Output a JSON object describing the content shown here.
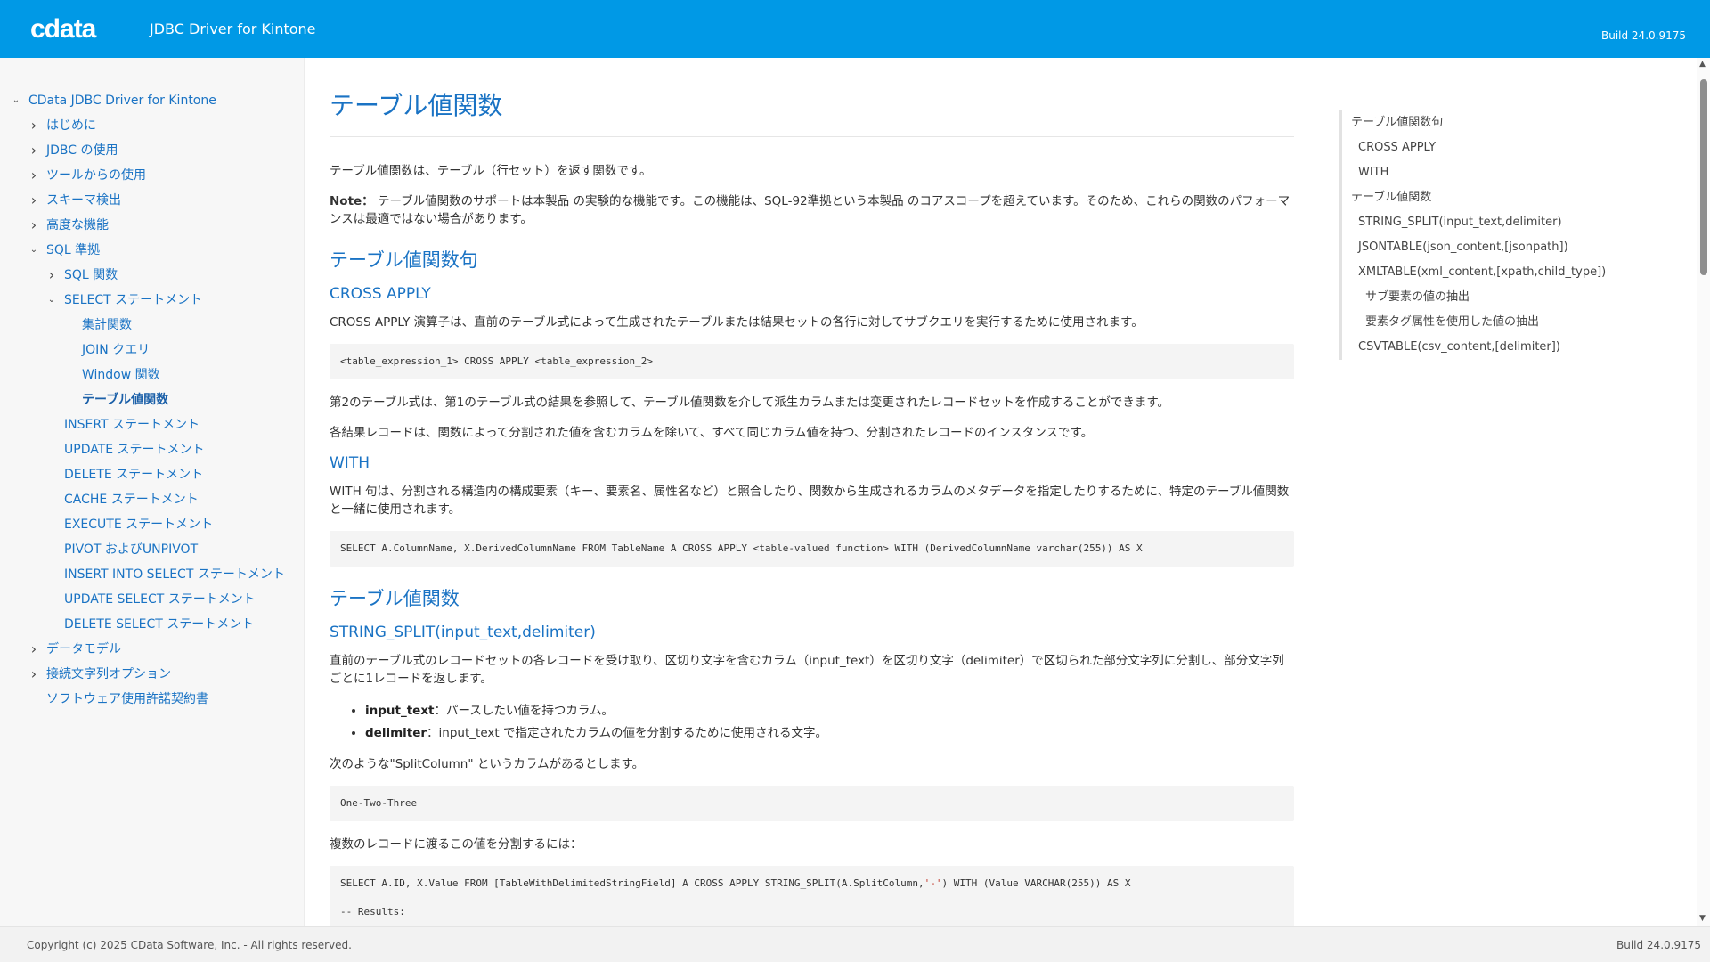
{
  "header": {
    "logo": "cdata",
    "product": "JDBC Driver for Kintone",
    "build": "Build 24.0.9175",
    "bg_color": "#0099e6"
  },
  "sidebar": {
    "items": [
      {
        "label": "CData JDBC Driver for Kintone",
        "level": 0,
        "chevron": "down"
      },
      {
        "label": "はじめに",
        "level": 1,
        "chevron": "right"
      },
      {
        "label": "JDBC の使用",
        "level": 1,
        "chevron": "right"
      },
      {
        "label": "ツールからの使用",
        "level": 1,
        "chevron": "right"
      },
      {
        "label": "スキーマ検出",
        "level": 1,
        "chevron": "right"
      },
      {
        "label": "高度な機能",
        "level": 1,
        "chevron": "right"
      },
      {
        "label": "SQL 準拠",
        "level": 1,
        "chevron": "down"
      },
      {
        "label": "SQL 関数",
        "level": 2,
        "chevron": "right"
      },
      {
        "label": "SELECT ステートメント",
        "level": 2,
        "chevron": "down"
      },
      {
        "label": "集計関数",
        "level": 3,
        "chevron": ""
      },
      {
        "label": "JOIN クエリ",
        "level": 3,
        "chevron": ""
      },
      {
        "label": "Window 関数",
        "level": 3,
        "chevron": ""
      },
      {
        "label": "テーブル値関数",
        "level": 3,
        "chevron": "",
        "active": true
      },
      {
        "label": "INSERT ステートメント",
        "level": 2,
        "chevron": ""
      },
      {
        "label": "UPDATE ステートメント",
        "level": 2,
        "chevron": ""
      },
      {
        "label": "DELETE ステートメント",
        "level": 2,
        "chevron": ""
      },
      {
        "label": "CACHE ステートメント",
        "level": 2,
        "chevron": ""
      },
      {
        "label": "EXECUTE ステートメント",
        "level": 2,
        "chevron": ""
      },
      {
        "label": "PIVOT およびUNPIVOT",
        "level": 2,
        "chevron": ""
      },
      {
        "label": "INSERT INTO SELECT ステートメント",
        "level": 2,
        "chevron": ""
      },
      {
        "label": "UPDATE SELECT ステートメント",
        "level": 2,
        "chevron": ""
      },
      {
        "label": "DELETE SELECT ステートメント",
        "level": 2,
        "chevron": ""
      },
      {
        "label": "データモデル",
        "level": 1,
        "chevron": "right"
      },
      {
        "label": "接続文字列オプション",
        "level": 1,
        "chevron": "right"
      },
      {
        "label": "ソフトウェア使用許諾契約書",
        "level": 1,
        "chevron": ""
      }
    ]
  },
  "main": {
    "title": "テーブル値関数",
    "intro": "テーブル値関数は、テーブル（行セット）を返す関数です。",
    "note_label": "Note：",
    "note_text": " テーブル値関数のサポートは本製品 の実験的な機能です。この機能は、SQL-92準拠という本製品 のコアスコープを超えています。そのため、これらの関数のパフォーマンスは最適ではない場合があります。",
    "sec1_title": "テーブル値関数句",
    "cross_apply_title": "CROSS APPLY",
    "cross_apply_desc": "CROSS APPLY 演算子は、直前のテーブル式によって生成されたテーブルまたは結果セットの各行に対してサブクエリを実行するために使用されます。",
    "cross_apply_code": "<table_expression_1> CROSS APPLY <table_expression_2>",
    "cross_apply_p2": "第2のテーブル式は、第1のテーブル式の結果を参照して、テーブル値関数を介して派生カラムまたは変更されたレコードセットを作成することができます。",
    "cross_apply_p3": "各結果レコードは、関数によって分割された値を含むカラムを除いて、すべて同じカラム値を持つ、分割されたレコードのインスタンスです。",
    "with_title": "WITH",
    "with_desc": "WITH 句は、分割される構造内の構成要素（キー、要素名、属性名など）と照合したり、関数から生成されるカラムのメタデータを指定したりするために、特定のテーブル値関数と一緒に使用されます。",
    "with_code": "SELECT A.ColumnName, X.DerivedColumnName FROM TableName A CROSS APPLY <table-valued function> WITH (DerivedColumnName varchar(255)) AS X",
    "sec2_title": "テーブル値関数",
    "split_title": "STRING_SPLIT(input_text,delimiter)",
    "split_desc": "直前のテーブル式のレコードセットの各レコードを受け取り、区切り文字を含むカラム（input_text）を区切り文字（delimiter）で区切られた部分文字列に分割し、部分文字列ごとに1レコードを返します。",
    "params": [
      {
        "name": "input_text",
        "desc": "：パースしたい値を持つカラム。"
      },
      {
        "name": "delimiter",
        "desc": "：input_text で指定されたカラムの値を分割するために使用される文字。"
      }
    ],
    "split_example_intro": "次のような\"SplitColumn\" というカラムがあるとします。",
    "split_example_code": "One-Two-Three",
    "split_query_intro": "複数のレコードに渡るこの値を分割するには：",
    "split_query_code_a": "SELECT A.ID, X.Value FROM [TableWithDelimitedStringField] A CROSS APPLY STRING_SPLIT(A.SplitColumn,",
    "split_query_code_str": "'-'",
    "split_query_code_b": ") WITH (Value VARCHAR(255)) AS X",
    "split_query_code_c": "-- Results:"
  },
  "toc": {
    "items": [
      {
        "label": "テーブル値関数句",
        "indent": 0
      },
      {
        "label": "CROSS APPLY",
        "indent": 1
      },
      {
        "label": "WITH",
        "indent": 1
      },
      {
        "label": "テーブル値関数",
        "indent": 0
      },
      {
        "label": "STRING_SPLIT(input_text,delimiter)",
        "indent": 1
      },
      {
        "label": "JSONTABLE(json_content,[jsonpath])",
        "indent": 1
      },
      {
        "label": "XMLTABLE(xml_content,[xpath,child_type])",
        "indent": 1
      },
      {
        "label": "サブ要素の値の抽出",
        "indent": 2
      },
      {
        "label": "要素タグ属性を使用した値の抽出",
        "indent": 2
      },
      {
        "label": "CSVTABLE(csv_content,[delimiter])",
        "indent": 1
      }
    ]
  },
  "footer": {
    "copyright": "Copyright (c) 2025 CData Software, Inc. - All rights reserved.",
    "build": "Build 24.0.9175"
  }
}
